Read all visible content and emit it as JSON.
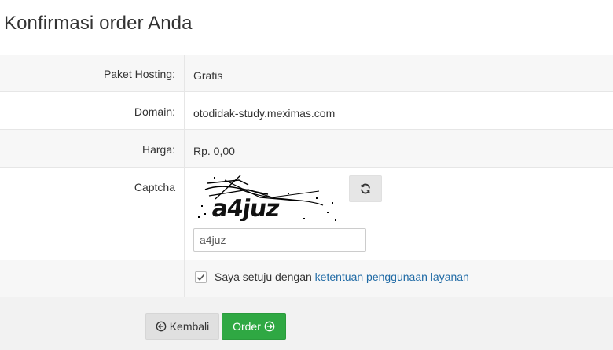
{
  "page": {
    "title": "Konfirmasi order Anda"
  },
  "form": {
    "paket": {
      "label": "Paket Hosting:",
      "value": "Gratis"
    },
    "domain": {
      "label": "Domain:",
      "value": "otodidak-study.meximas.com"
    },
    "harga": {
      "label": "Harga:",
      "value": "Rp. 0,00"
    },
    "captcha": {
      "label": "Captcha",
      "image_text": "a4juz",
      "input_value": "a4juz",
      "refresh_icon": "refresh-icon"
    },
    "agree": {
      "checked": true,
      "text": "Saya setuju dengan ",
      "link": "ketentuan penggunaan layanan"
    }
  },
  "footer": {
    "back_label": "Kembali",
    "order_label": "Order",
    "back_icon": "arrow-left-circle-icon",
    "order_icon": "arrow-right-circle-icon"
  },
  "colors": {
    "order_button": "#2fa843",
    "link": "#1f6aa5",
    "row_shade": "#f7f7f7"
  }
}
